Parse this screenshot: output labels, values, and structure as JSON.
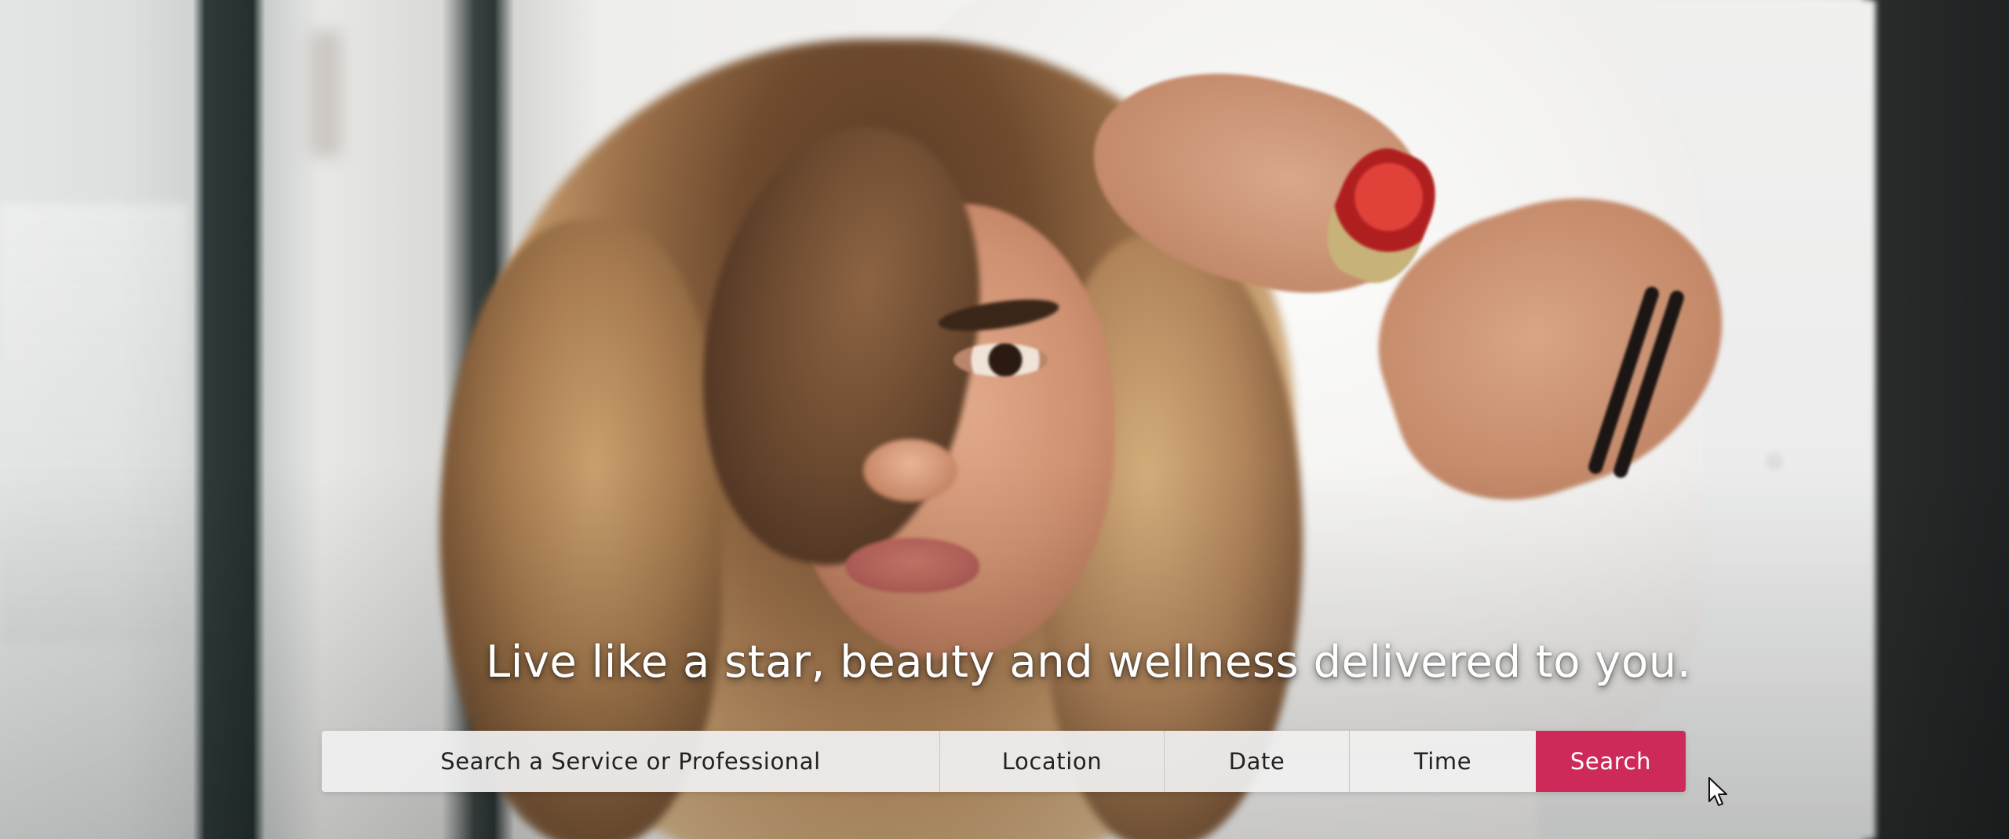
{
  "hero": {
    "tagline": "Live like a star, beauty and wellness delivered to you."
  },
  "search": {
    "service_placeholder": "Search a Service or Professional",
    "location_placeholder": "Location",
    "date_placeholder": "Date",
    "time_placeholder": "Time",
    "button_label": "Search"
  },
  "colors": {
    "accent": "#cd2a5a",
    "field_background": "#f0f0f0",
    "field_text": "#222222",
    "tagline_text": "#ffffff"
  },
  "icons": {
    "pointer": "mouse-pointer-icon"
  }
}
